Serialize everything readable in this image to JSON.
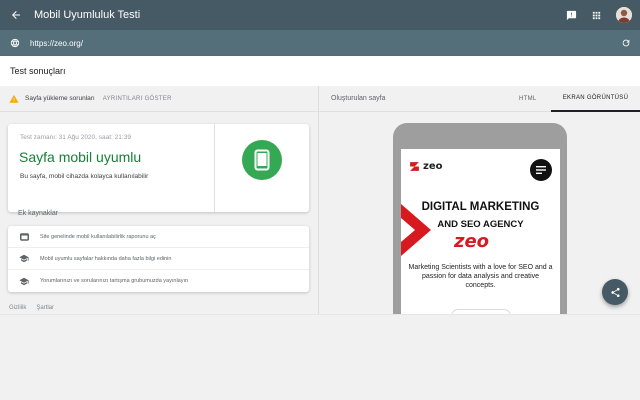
{
  "app": {
    "title": "Mobil Uyumluluk Testi"
  },
  "url_bar": {
    "url": "https://zeo.org/"
  },
  "page": {
    "section_title": "Test sonuçları"
  },
  "warning": {
    "text": "Sayfa yükleme sorunları",
    "link": "AYRINTILARI GÖSTER"
  },
  "result_card": {
    "time": "Test zamanı: 31 Ağu 2020, saat: 21:39",
    "headline": "Sayfa mobil uyumlu",
    "description": "Bu sayfa, mobil cihazda kolayca kullanılabilir"
  },
  "resources": {
    "heading": "Ek kaynaklar",
    "items": [
      {
        "label": "Site genelinde mobil kullanılabilirlik raporunu aç",
        "icon": "web-icon"
      },
      {
        "label": "Mobil uyumlu sayfalar hakkında daha fazla bilgi edinin",
        "icon": "school-icon"
      },
      {
        "label": "Yorumlarınızı ve sorularınızı tartışma grubumuzda yayınlayın",
        "icon": "school-icon"
      }
    ]
  },
  "footer": {
    "privacy": "Gizlilik",
    "terms": "Şartlar"
  },
  "right_panel": {
    "label": "Oluşturulan sayfa",
    "tab_html": "HTML",
    "tab_screenshot": "EKRAN GÖRÜNTÜSÜ"
  },
  "preview": {
    "logo": "zeo",
    "heading_line1": "DIGITAL MARKETING",
    "heading_line2": "AND SEO AGENCY",
    "brand": "zeo",
    "description": "Marketing Scientists with a love for SEO and a passion for data analysis and creative concepts."
  },
  "colors": {
    "topbar": "#455a64",
    "urlbar": "#546e7a",
    "success": "#188038",
    "success_circle": "#34a853",
    "brand_red": "#d71920",
    "warning": "#f9ab00"
  }
}
